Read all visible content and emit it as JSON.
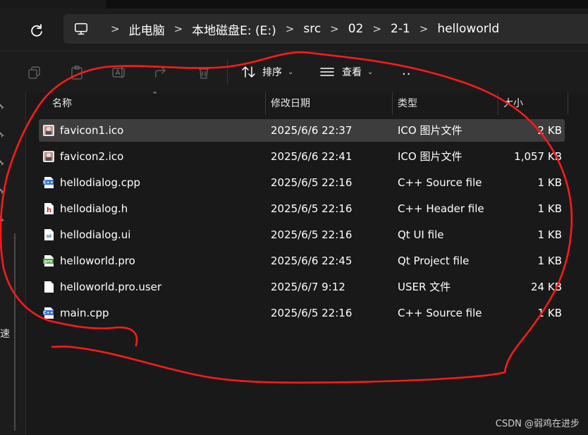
{
  "breadcrumbs": [
    "此电脑",
    "本地磁盘E: (E:)",
    "src",
    "02",
    "2-1",
    "helloworld"
  ],
  "toolbar": {
    "sort_label": "排序",
    "view_label": "查看",
    "more_label": "··"
  },
  "columns": {
    "name": "名称",
    "date": "修改日期",
    "type": "类型",
    "size": "大小"
  },
  "files": [
    {
      "name": "favicon1.ico",
      "date": "2025/6/6 22:37",
      "type": "ICO 图片文件",
      "size": "2 KB",
      "icon": "ico-image-icon",
      "selected": true
    },
    {
      "name": "favicon2.ico",
      "date": "2025/6/6 22:41",
      "type": "ICO 图片文件",
      "size": "1,057 KB",
      "icon": "ico-image-icon",
      "selected": false
    },
    {
      "name": "hellodialog.cpp",
      "date": "2025/6/5 22:16",
      "type": "C++ Source file",
      "size": "1 KB",
      "icon": "cpp-file-icon",
      "selected": false
    },
    {
      "name": "hellodialog.h",
      "date": "2025/6/5 22:16",
      "type": "C++ Header file",
      "size": "1 KB",
      "icon": "h-file-icon",
      "selected": false
    },
    {
      "name": "hellodialog.ui",
      "date": "2025/6/5 22:16",
      "type": "Qt UI file",
      "size": "1 KB",
      "icon": "ui-file-icon",
      "selected": false
    },
    {
      "name": "helloworld.pro",
      "date": "2025/6/6 22:45",
      "type": "Qt Project file",
      "size": "1 KB",
      "icon": "pro-file-icon",
      "selected": false
    },
    {
      "name": "helloworld.pro.user",
      "date": "2025/6/7 9:12",
      "type": "USER 文件",
      "size": "24 KB",
      "icon": "blank-file-icon",
      "selected": false
    },
    {
      "name": "main.cpp",
      "date": "2025/6/5 22:16",
      "type": "C++ Source file",
      "size": "1 KB",
      "icon": "cpp-file-icon",
      "selected": false
    }
  ],
  "nav": {
    "truncated_label": "速"
  },
  "watermark": "CSDN @弱鸡在进步",
  "colors": {
    "annotation": "#ff1a1a",
    "selection": "#3d3d3d",
    "background": "#191919"
  }
}
